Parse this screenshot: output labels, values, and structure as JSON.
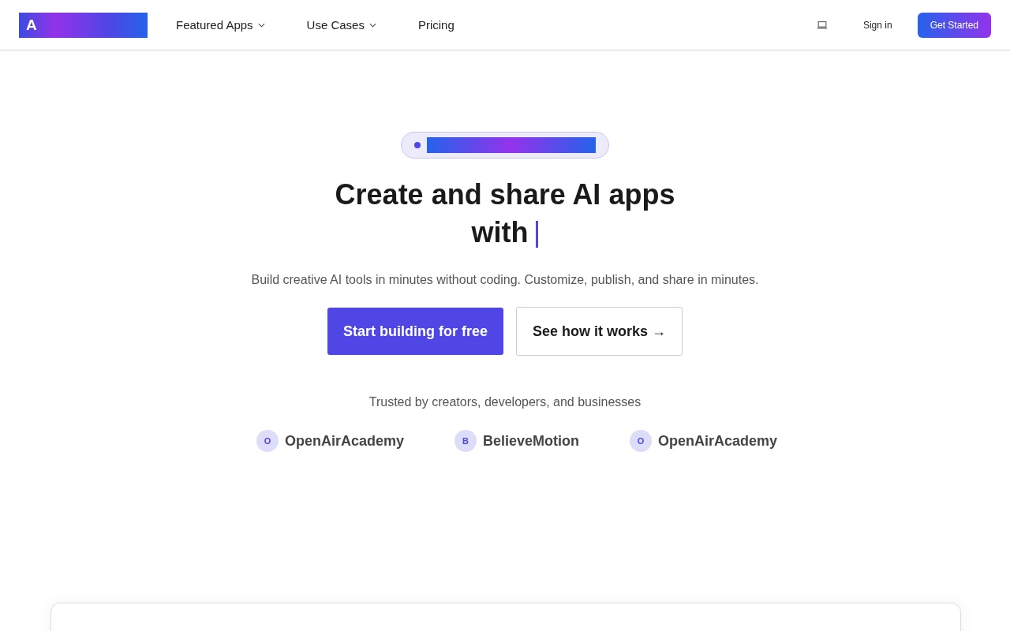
{
  "header": {
    "logo": {
      "letter": "A"
    },
    "nav": [
      {
        "label": "Featured Apps",
        "dropdown": true
      },
      {
        "label": "Use Cases",
        "dropdown": true
      },
      {
        "label": "Pricing",
        "dropdown": false
      }
    ],
    "sign_in": "Sign in",
    "cta": "Get Started"
  },
  "hero": {
    "heading_line_1": "Create and share AI apps",
    "heading_line_2": "with",
    "subtitle": "Build creative AI tools in minutes without coding. Customize, publish, and share in minutes.",
    "primary_button": "Start building for free",
    "secondary_button": "See how it works →",
    "trusted": "Trusted by creators, developers, and businesses",
    "logos": [
      {
        "initial": "O",
        "name": "OpenAirAcademy"
      },
      {
        "initial": "B",
        "name": "BelieveMotion"
      },
      {
        "initial": "O",
        "name": "OpenAirAcademy"
      }
    ]
  }
}
